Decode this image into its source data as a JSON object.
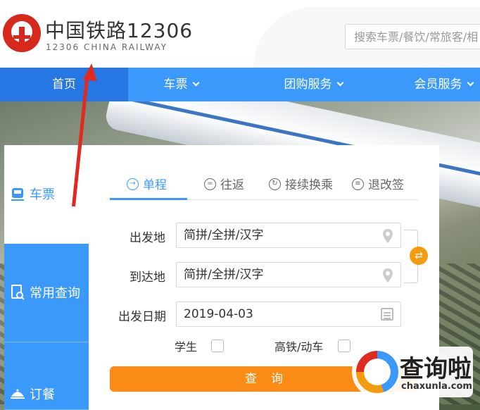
{
  "header": {
    "logo_title": "中国铁路12306",
    "logo_subtitle": "12306 CHINA RAILWAY",
    "search_placeholder": "搜索车票/餐饮/常旅客/相"
  },
  "nav": {
    "items": [
      {
        "label": "首页",
        "active": true,
        "dropdown": false
      },
      {
        "label": "车票",
        "active": false,
        "dropdown": true
      },
      {
        "label": "团购服务",
        "active": false,
        "dropdown": true
      },
      {
        "label": "会员服务",
        "active": false,
        "dropdown": true
      }
    ]
  },
  "sidebar": {
    "items": [
      {
        "label": "车票",
        "icon": "train-icon",
        "active": true
      },
      {
        "label": "常用查询",
        "icon": "search-doc-icon",
        "active": false
      },
      {
        "label": "订餐",
        "icon": "food-cover-icon",
        "active": false
      }
    ]
  },
  "tabs": {
    "items": [
      {
        "label": "单程",
        "icon": "arrow-right-circle-icon",
        "active": true
      },
      {
        "label": "往返",
        "icon": "equals-circle-icon",
        "active": false
      },
      {
        "label": "接续换乘",
        "icon": "swap-circle-icon",
        "active": false
      },
      {
        "label": "退改签",
        "icon": "doc-circle-icon",
        "active": false
      }
    ]
  },
  "form": {
    "from_label": "出发地",
    "from_value": "简拼/全拼/汉字",
    "to_label": "到达地",
    "to_value": "简拼/全拼/汉字",
    "date_label": "出发日期",
    "date_value": "2019-04-03",
    "student_label": "学生",
    "student_checked": false,
    "highspeed_label": "高铁/动车",
    "highspeed_checked": false,
    "query_label": "查询"
  },
  "watermark": {
    "title": "查询啦",
    "url": "chaxunla.com"
  },
  "colors": {
    "brand_blue": "#3b99fc",
    "nav_active": "#2676e3",
    "orange": "#fa8c16",
    "logo_red": "#d6281d",
    "annotation_red": "#e02a20"
  }
}
